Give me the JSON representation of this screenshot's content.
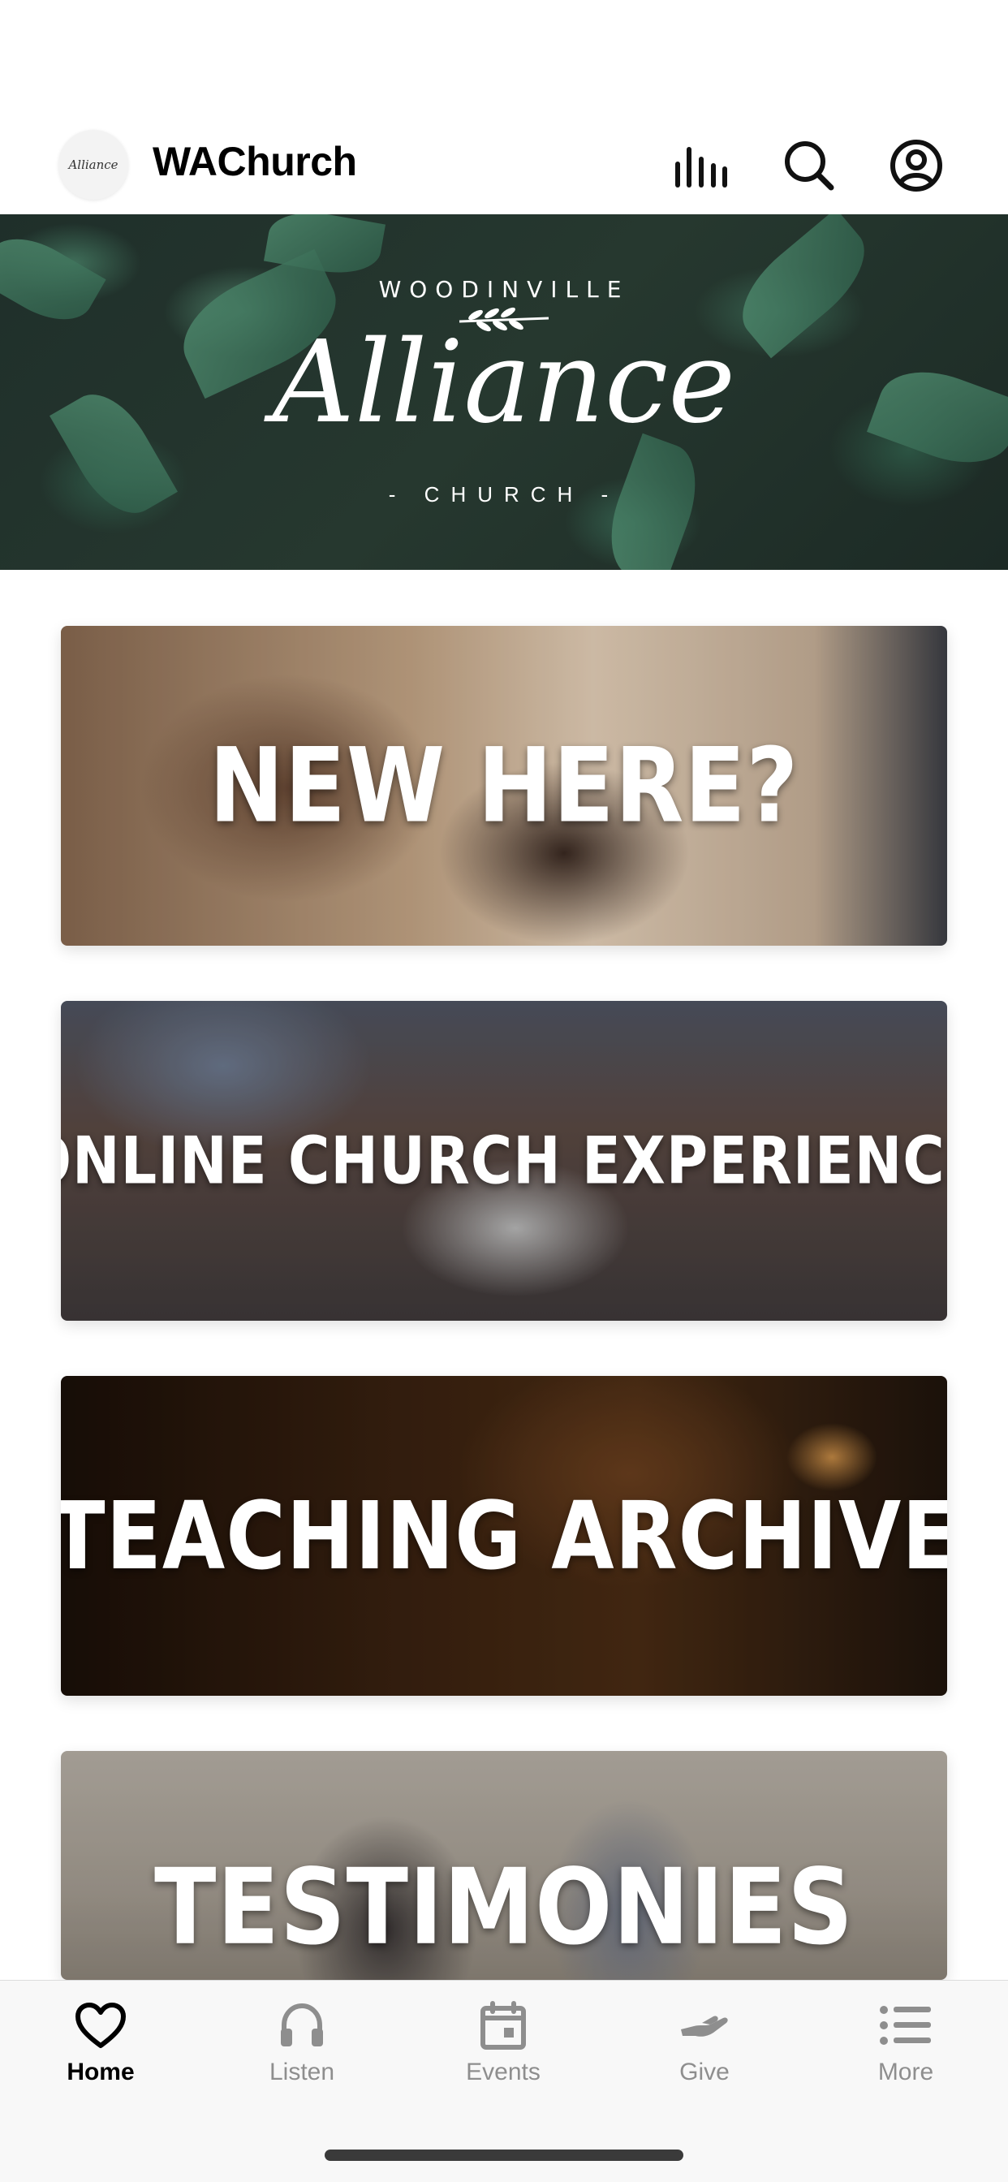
{
  "header": {
    "logo_text": "Alliance",
    "title": "WAChurch",
    "icons": [
      "audio-bars-icon",
      "search-icon",
      "profile-icon"
    ]
  },
  "banner": {
    "top_text": "WOODINVILLE",
    "main_text": "Alliance",
    "bottom_text": "- CHURCH -"
  },
  "cards": [
    {
      "label": "NEW HERE?"
    },
    {
      "label": "ONLINE CHURCH EXPERIENCE"
    },
    {
      "label": "TEACHING ARCHIVE"
    },
    {
      "label": "TESTIMONIES"
    }
  ],
  "tabbar": {
    "items": [
      {
        "label": "Home",
        "icon": "heart-icon",
        "active": true
      },
      {
        "label": "Listen",
        "icon": "headphones-icon",
        "active": false
      },
      {
        "label": "Events",
        "icon": "calendar-icon",
        "active": false
      },
      {
        "label": "Give",
        "icon": "give-hand-icon",
        "active": false
      },
      {
        "label": "More",
        "icon": "list-icon",
        "active": false
      }
    ]
  },
  "colors": {
    "active_tab": "#000000",
    "inactive_tab": "#8e8e8e",
    "tabbar_bg": "#f8f8f8"
  }
}
